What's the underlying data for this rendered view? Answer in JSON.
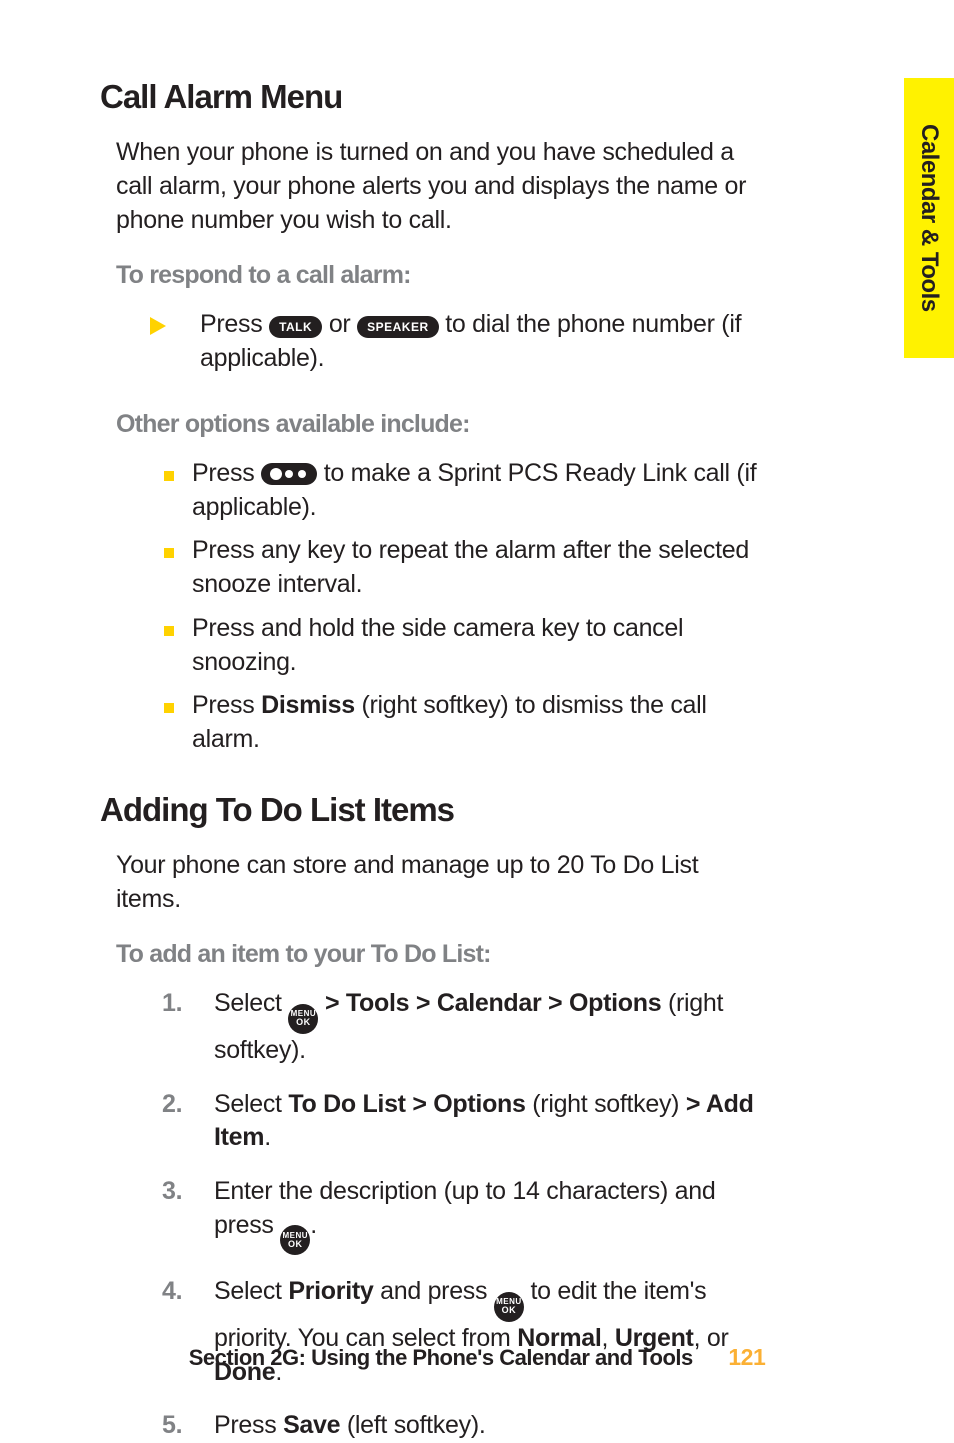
{
  "sideTab": "Calendar & Tools",
  "section1": {
    "heading": "Call Alarm Menu",
    "intro": "When your phone is turned on and you have scheduled a call alarm, your phone alerts you and displays the name or phone number you wish to call.",
    "sub1": "To respond to a call alarm:",
    "arrow1_pre": "Press ",
    "btn_talk": "TALK",
    "arrow1_mid": " or ",
    "btn_speaker": "SPEAKER",
    "arrow1_post": " to dial the phone number (if applicable).",
    "sub2": "Other options available include:",
    "bullets": [
      {
        "pre": "Press ",
        "hasDots": true,
        "post": " to make a Sprint PCS Ready Link call (if applicable)."
      },
      {
        "text": "Press any key to repeat the alarm after the selected snooze interval."
      },
      {
        "text": "Press and hold the side camera key to cancel snoozing."
      },
      {
        "pre": "Press ",
        "bold": "Dismiss",
        "post": " (right softkey) to dismiss the call alarm."
      }
    ]
  },
  "section2": {
    "heading": "Adding To Do List Items",
    "intro": "Your phone can store and manage up to 20 To Do List items.",
    "sub": "To add an item to your To Do List:",
    "steps": {
      "s1_pre": "Select ",
      "s1_post_bold": " > Tools > Calendar > Options",
      "s1_tail": " (right softkey).",
      "s2_pre": "Select ",
      "s2_bold1": "To Do List > Options",
      "s2_mid": " (right softkey) ",
      "s2_bold2": "> Add Item",
      "s2_tail": ".",
      "s3_pre": "Enter the description (up to 14 characters) and press ",
      "s3_tail": ".",
      "s4_pre": "Select ",
      "s4_bold1": "Priority",
      "s4_mid1": " and press ",
      "s4_mid2": " to edit the item's priority. You can select from ",
      "s4_bold2": "Normal",
      "s4_sep1": ", ",
      "s4_bold3": "Urgent",
      "s4_sep2": ", or ",
      "s4_bold4": "Done",
      "s4_tail": ".",
      "s5_pre": "Press ",
      "s5_bold": "Save",
      "s5_tail": " (left softkey)."
    }
  },
  "menuTop": "MENU",
  "menuBot": "OK",
  "footer": {
    "text": "Section 2G: Using the Phone's Calendar and Tools",
    "page": "121"
  }
}
